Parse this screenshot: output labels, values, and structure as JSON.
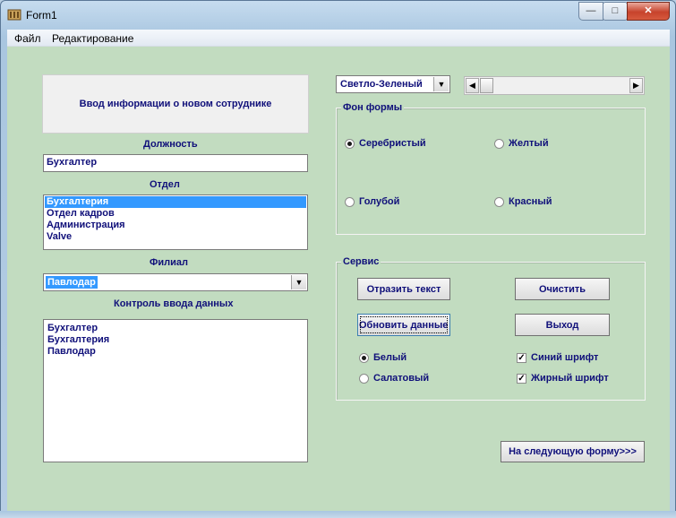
{
  "window": {
    "title": "Form1",
    "controls": {
      "minimize": "—",
      "maximize": "□",
      "close": "✕"
    }
  },
  "menu": [
    "Файл",
    "Редактирование"
  ],
  "header_panel": {
    "text": "Ввод информации о новом сотруднике"
  },
  "position": {
    "label": "Должность",
    "value": "Бухгалтер"
  },
  "department": {
    "label": "Отдел",
    "items": [
      {
        "text": "Бухгалтерия",
        "selected": true
      },
      {
        "text": "Отдел кадров",
        "selected": false
      },
      {
        "text": "Администрация",
        "selected": false
      },
      {
        "text": "Valve",
        "selected": false
      }
    ]
  },
  "branch": {
    "label": "Филиал",
    "value": "Павлодар"
  },
  "data_control": {
    "label": "Контроль ввода данных",
    "lines": [
      "Бухгалтер",
      "Бухгалтерия",
      "Павлодар"
    ]
  },
  "color_combo": {
    "value": "Светло-Зеленый"
  },
  "background_group": {
    "title": "Фон формы",
    "options": [
      {
        "text": "Серебристый",
        "checked": true
      },
      {
        "text": "Желтый",
        "checked": false
      },
      {
        "text": "Голубой",
        "checked": false
      },
      {
        "text": "Красный",
        "checked": false
      }
    ]
  },
  "service_group": {
    "title": "Сервис",
    "buttons": {
      "reflect": "Отразить текст",
      "clear": "Очистить",
      "update": "Обновить данные",
      "exit": "Выход"
    },
    "radios": [
      {
        "text": "Белый",
        "checked": true
      },
      {
        "text": "Салатовый",
        "checked": false
      }
    ],
    "checks": [
      {
        "text": "Синий шрифт",
        "checked": true
      },
      {
        "text": "Жирный шрифт",
        "checked": true
      }
    ]
  },
  "next_form_button": "На следующую форму>>>",
  "colors": {
    "form_background": "#c2dcc0",
    "label_text": "#10107a",
    "selection": "#3399ff"
  }
}
